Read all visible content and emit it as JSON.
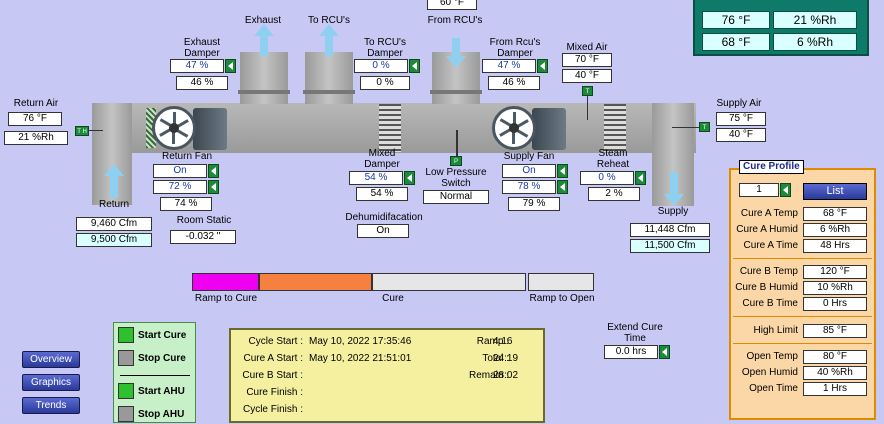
{
  "colors": {
    "background": "#c8c8f5",
    "button_green": "#1c8a3a",
    "ramp_to_cure": "#f000f0",
    "cure": "#f58040",
    "ramp_to_open": "#e6e6e6"
  },
  "room": {
    "temp1": "76 °F",
    "humid1": "21 %Rh",
    "temp2": "68 °F",
    "humid2": "6 %Rh"
  },
  "return_air": {
    "label": "Return Air",
    "temp": "76 °F",
    "humid": "21 %Rh",
    "sensor": "T H"
  },
  "exhaust": {
    "label": "Exhaust"
  },
  "to_rcus": {
    "label": "To RCU's"
  },
  "from_rcus": {
    "label": "From RCU's",
    "value": "60 °F"
  },
  "exhaust_damper": {
    "label": "Exhaust Damper",
    "setpoint": "47 %",
    "feedback": "46 %"
  },
  "to_rcus_damper": {
    "label": "To RCU's Damper",
    "setpoint": "0 %",
    "feedback": "0 %"
  },
  "from_rcus_damper": {
    "label": "From Rcu's Damper",
    "setpoint": "47 %",
    "feedback": "46 %"
  },
  "mixed_air": {
    "label": "Mixed Air",
    "temp1": "70 °F",
    "temp2": "40 °F",
    "sensor": "T"
  },
  "supply_air": {
    "label": "Supply Air",
    "temp1": "75 °F",
    "temp2": "40 °F",
    "sensor": "T"
  },
  "return_fan": {
    "label": "Return Fan",
    "status": "On",
    "speed_cmd": "72 %",
    "speed_fb": "74 %"
  },
  "return": {
    "label": "Return",
    "cfm1": "9,460 Cfm",
    "cfm2": "9,500 Cfm"
  },
  "room_static": {
    "label": "Room Static",
    "value": "-0.032 \""
  },
  "mixed_damper": {
    "label": "Mixed Damper",
    "setpoint": "54 %",
    "feedback": "54 %"
  },
  "dehumidification": {
    "label": "Dehumidifacation",
    "value": "On"
  },
  "low_pressure": {
    "label": "Low Pressure Switch",
    "value": "Normal",
    "sensor": "P"
  },
  "supply_fan": {
    "label": "Supply Fan",
    "status": "On",
    "speed_cmd": "78 %",
    "speed_fb": "79 %"
  },
  "steam_reheat": {
    "label": "Steam Reheat",
    "setpoint": "0 %",
    "feedback": "2 %"
  },
  "supply": {
    "label": "Supply",
    "cfm1": "11,448 Cfm",
    "cfm2": "11,500 Cfm"
  },
  "cure_profile": {
    "title": "Cure Profile",
    "selected": "1",
    "list_label": "List",
    "rows": [
      {
        "label": "Cure A Temp",
        "value": "68 °F"
      },
      {
        "label": "Cure A Humid",
        "value": "6 %Rh"
      },
      {
        "label": "Cure A Time",
        "value": "48 Hrs"
      },
      {
        "label": "Cure B Temp",
        "value": "120 °F"
      },
      {
        "label": "Cure B Humid",
        "value": "10 %Rh"
      },
      {
        "label": "Cure B Time",
        "value": "0 Hrs"
      },
      {
        "label": "High Limit",
        "value": "85 °F"
      },
      {
        "label": "Open Temp",
        "value": "80 °F"
      },
      {
        "label": "Open Humid",
        "value": "40 %Rh"
      },
      {
        "label": "Open Time",
        "value": "1 Hrs"
      }
    ]
  },
  "progress": {
    "ramp_to_cure": "Ramp to Cure",
    "cure": "Cure",
    "ramp_to_open": "Ramp to Open"
  },
  "extend_cure": {
    "label": "Extend Cure Time",
    "value": "0.0 hrs"
  },
  "controls": {
    "start_cure": "Start Cure",
    "stop_cure": "Stop Cure",
    "start_ahu": "Start AHU",
    "stop_ahu": "Stop AHU"
  },
  "nav": {
    "overview": "Overview",
    "graphics": "Graphics",
    "trends": "Trends"
  },
  "status": {
    "cycle_start_label": "Cycle Start :",
    "cycle_start": "May 10, 2022  17:35:46",
    "cure_a_start_label": "Cure A Start :",
    "cure_a_start": "May 10, 2022  21:51:01",
    "cure_b_start_label": "Cure B Start :",
    "cure_finish_label": "Cure Finish :",
    "cycle_finish_label": "Cycle Finish :",
    "ramp_label": "Ramp :",
    "ramp": "4:16",
    "total_label": "Total :",
    "total": "24:19",
    "remain_label": "Remain :",
    "remain": "28:02"
  }
}
